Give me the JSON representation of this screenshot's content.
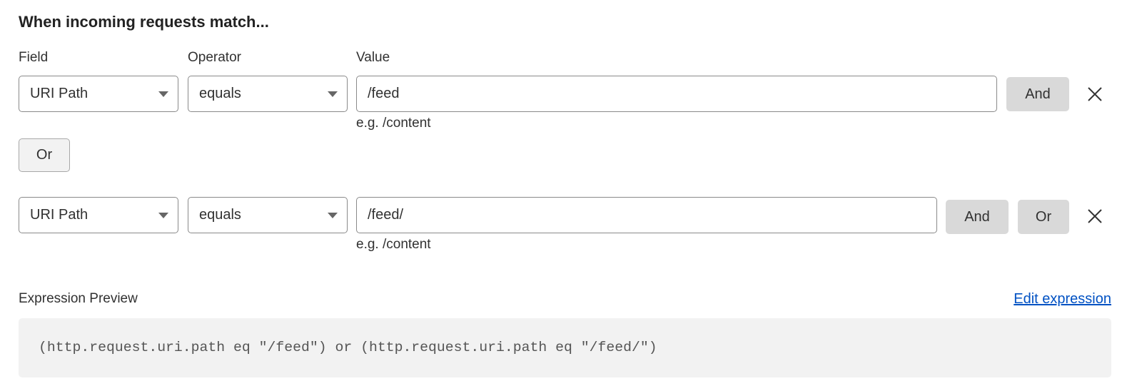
{
  "section_title": "When incoming requests match...",
  "labels": {
    "field": "Field",
    "operator": "Operator",
    "value": "Value"
  },
  "rows": [
    {
      "field": "URI Path",
      "operator": "equals",
      "value": "/feed",
      "hint": "e.g. /content",
      "and_label": "And"
    },
    {
      "field": "URI Path",
      "operator": "equals",
      "value": "/feed/",
      "hint": "e.g. /content",
      "and_label": "And",
      "or_label": "Or"
    }
  ],
  "or_group_label": "Or",
  "preview": {
    "label": "Expression Preview",
    "edit_link": "Edit expression",
    "expression": "(http.request.uri.path eq \"/feed\") or (http.request.uri.path eq \"/feed/\")"
  },
  "colors": {
    "link": "#0051c3",
    "button_bg": "#d9d9d9",
    "preview_bg": "#f2f2f2"
  }
}
